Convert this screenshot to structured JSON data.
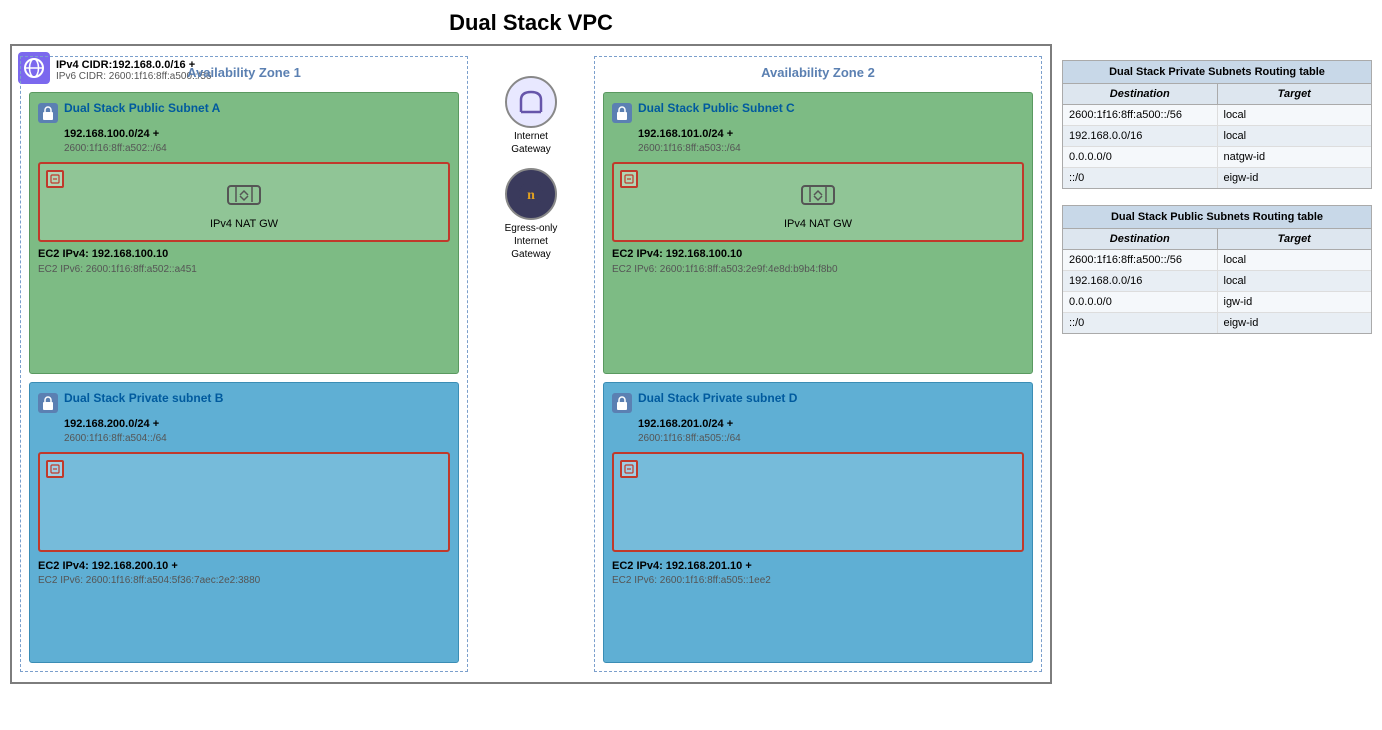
{
  "title": "Dual Stack VPC",
  "vpc": {
    "ipv4_cidr_label": "IPv4 CIDR:192.168.0.0/16 +",
    "ipv6_cidr_label": "IPv6 CIDR: 2600:1f16:8ff:a500::/56"
  },
  "az1": {
    "title": "Availability Zone 1",
    "public_subnet": {
      "name": "Dual Stack Public Subnet A",
      "ipv4": "192.168.100.0/24 +",
      "ipv6": "2600:1f16:8ff:a502::/64",
      "nat_gw_label": "IPv4 NAT GW",
      "ec2_ipv4": "EC2 IPv4: 192.168.100.10",
      "ec2_ipv6": "EC2 IPv6: 2600:1f16:8ff:a502::a451"
    },
    "private_subnet": {
      "name": "Dual Stack Private subnet B",
      "ipv4": "192.168.200.0/24 +",
      "ipv6": "2600:1f16:8ff:a504::/64",
      "ec2_ipv4": "EC2 IPv4: 192.168.200.10 +",
      "ec2_ipv6": "EC2 IPv6: 2600:1f16:8ff:a504:5f36:7aec:2e2:3880"
    }
  },
  "az2": {
    "title": "Availability Zone 2",
    "public_subnet": {
      "name": "Dual Stack Public Subnet C",
      "ipv4": "192.168.101.0/24 +",
      "ipv6": "2600:1f16:8ff:a503::/64",
      "nat_gw_label": "IPv4 NAT GW",
      "ec2_ipv4": "EC2 IPv4: 192.168.100.10",
      "ec2_ipv6": "EC2 IPv6: 2600:1f16:8ff:a503:2e9f:4e8d:b9b4:f8b0"
    },
    "private_subnet": {
      "name": "Dual Stack Private subnet D",
      "ipv4": "192.168.201.0/24 +",
      "ipv6": "2600:1f16:8ff:a505::/64",
      "ec2_ipv4": "EC2 IPv4: 192.168.201.10 +",
      "ec2_ipv6": "EC2 IPv6: 2600:1f16:8ff:a505::1ee2"
    }
  },
  "gateways": {
    "internet": {
      "label": "Internet\nGateway"
    },
    "egress": {
      "label": "Egress-only\nInternet\nGateway"
    }
  },
  "routing_tables": {
    "private": {
      "title": "Dual Stack Private Subnets Routing table",
      "col1": "Destination",
      "col2": "Target",
      "rows": [
        {
          "dest": "2600:1f16:8ff:a500::/56",
          "target": "local"
        },
        {
          "dest": "192.168.0.0/16",
          "target": "local"
        },
        {
          "dest": "0.0.0.0/0",
          "target": "natgw-id"
        },
        {
          "dest": "::/0",
          "target": "eigw-id"
        }
      ]
    },
    "public": {
      "title": "Dual Stack Public Subnets Routing table",
      "col1": "Destination",
      "col2": "Target",
      "rows": [
        {
          "dest": "2600:1f16:8ff:a500::/56",
          "target": "local"
        },
        {
          "dest": "192.168.0.0/16",
          "target": "local"
        },
        {
          "dest": "0.0.0.0/0",
          "target": "igw-id"
        },
        {
          "dest": "::/0",
          "target": "eigw-id"
        }
      ]
    }
  }
}
